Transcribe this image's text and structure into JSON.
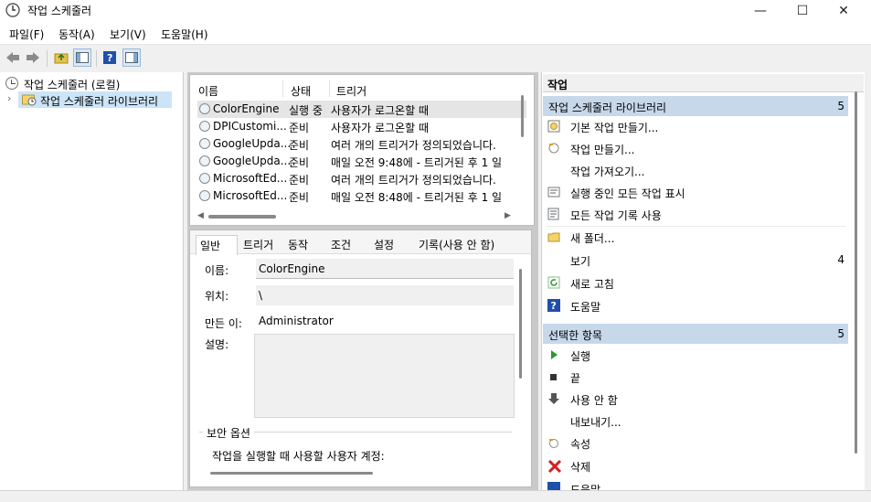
{
  "window": {
    "title": "작업 스케줄러",
    "min": "—",
    "max": "☐",
    "close": "✕"
  },
  "menu": [
    "파일(F)",
    "동작(A)",
    "보기(V)",
    "도움말(H)"
  ],
  "tree": {
    "root": "작업 스케줄러 (로컬)",
    "child": "작업 스케줄러 라이브러리"
  },
  "list": {
    "columns": [
      "이름",
      "상태",
      "트리거"
    ],
    "rows": [
      {
        "name": "ColorEngine",
        "status": "실행 중",
        "trigger": "사용자가 로그온할 때"
      },
      {
        "name": "DPICustomi...",
        "status": "준비",
        "trigger": "사용자가 로그온할 때"
      },
      {
        "name": "GoogleUpda...",
        "status": "준비",
        "trigger": "여러 개의 트리거가 정의되었습니다."
      },
      {
        "name": "GoogleUpda...",
        "status": "준비",
        "trigger": "매일 오전 9:48에 - 트리거된 후 1 일"
      },
      {
        "name": "MicrosoftEd...",
        "status": "준비",
        "trigger": "여러 개의 트리거가 정의되었습니다."
      },
      {
        "name": "MicrosoftEd...",
        "status": "준비",
        "trigger": "매일 오전 8:48에 - 트리거된 후 1 일"
      }
    ]
  },
  "tabs": [
    "일반",
    "트리거",
    "동작",
    "조건",
    "설정",
    "기록(사용 안 함)"
  ],
  "general": {
    "name_label": "이름:",
    "name_value": "ColorEngine",
    "location_label": "위치:",
    "location_value": "\\",
    "author_label": "만든 이:",
    "author_value": "Administrator",
    "desc_label": "설명:",
    "security_label": "보안 옵션",
    "security_text": "작업을 실행할 때 사용할 사용자 계정:"
  },
  "actions": {
    "header": "작업",
    "section1": {
      "title": "작업 스케줄러 라이브러리",
      "count": "5"
    },
    "items1": [
      {
        "label": "기본 작업 만들기...",
        "icon": "basic-task-icon"
      },
      {
        "label": "작업 만들기...",
        "icon": "create-task-icon"
      },
      {
        "label": "작업 가져오기...",
        "icon": ""
      },
      {
        "label": "실행 중인 모든 작업 표시",
        "icon": "running-tasks-icon"
      },
      {
        "label": "모든 작업 기록 사용",
        "icon": "history-icon"
      },
      {
        "label": "새 폴더...",
        "icon": "folder-icon"
      },
      {
        "label": "보기",
        "icon": "",
        "count": "4"
      },
      {
        "label": "새로 고침",
        "icon": "refresh-icon"
      },
      {
        "label": "도움말",
        "icon": "help-icon"
      }
    ],
    "section2": {
      "title": "선택한 항목",
      "count": "5"
    },
    "items2": [
      {
        "label": "실행",
        "icon": "run-icon"
      },
      {
        "label": "끝",
        "icon": "stop-icon"
      },
      {
        "label": "사용 안 함",
        "icon": "disable-icon"
      },
      {
        "label": "내보내기...",
        "icon": ""
      },
      {
        "label": "속성",
        "icon": "properties-icon"
      },
      {
        "label": "삭제",
        "icon": "delete-icon"
      },
      {
        "label": "도움말",
        "icon": "help-icon"
      }
    ]
  },
  "colors": {
    "section_bg": "#c7d8ea",
    "selected_row": "#e5e5e5",
    "help_blue": "#1f4fa8",
    "run_green": "#2a9a2a",
    "delete_red": "#d21f1f"
  }
}
